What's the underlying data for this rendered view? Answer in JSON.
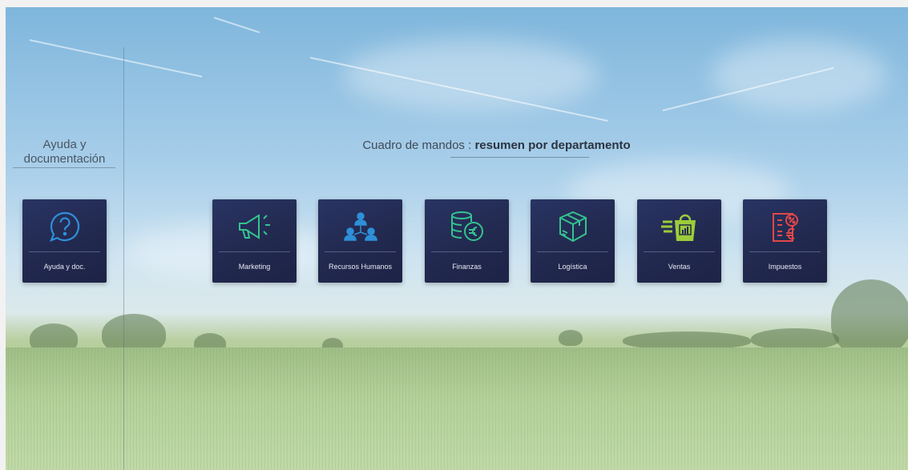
{
  "sidebar": {
    "title": "Ayuda y documentación",
    "tile": {
      "label": "Ayuda y doc.",
      "icon": "help-bubble-icon",
      "color": "#2f8fd8"
    }
  },
  "header": {
    "title_prefix": "Cuadro de mandos : ",
    "title_bold": "resumen por departamento"
  },
  "tiles": [
    {
      "label": "Marketing",
      "icon": "megaphone-icon",
      "color": "#34c38f"
    },
    {
      "label": "Recursos Humanos",
      "icon": "people-network-icon",
      "color": "#2f8fd8"
    },
    {
      "label": "Finanzas",
      "icon": "coins-euro-icon",
      "color": "#34c38f"
    },
    {
      "label": "Logística",
      "icon": "box-package-icon",
      "color": "#34c38f"
    },
    {
      "label": "Ventas",
      "icon": "shopping-bag-chart-icon",
      "color": "#9ccc3a"
    },
    {
      "label": "Impuestos",
      "icon": "tax-document-icon",
      "color": "#e04848"
    }
  ]
}
